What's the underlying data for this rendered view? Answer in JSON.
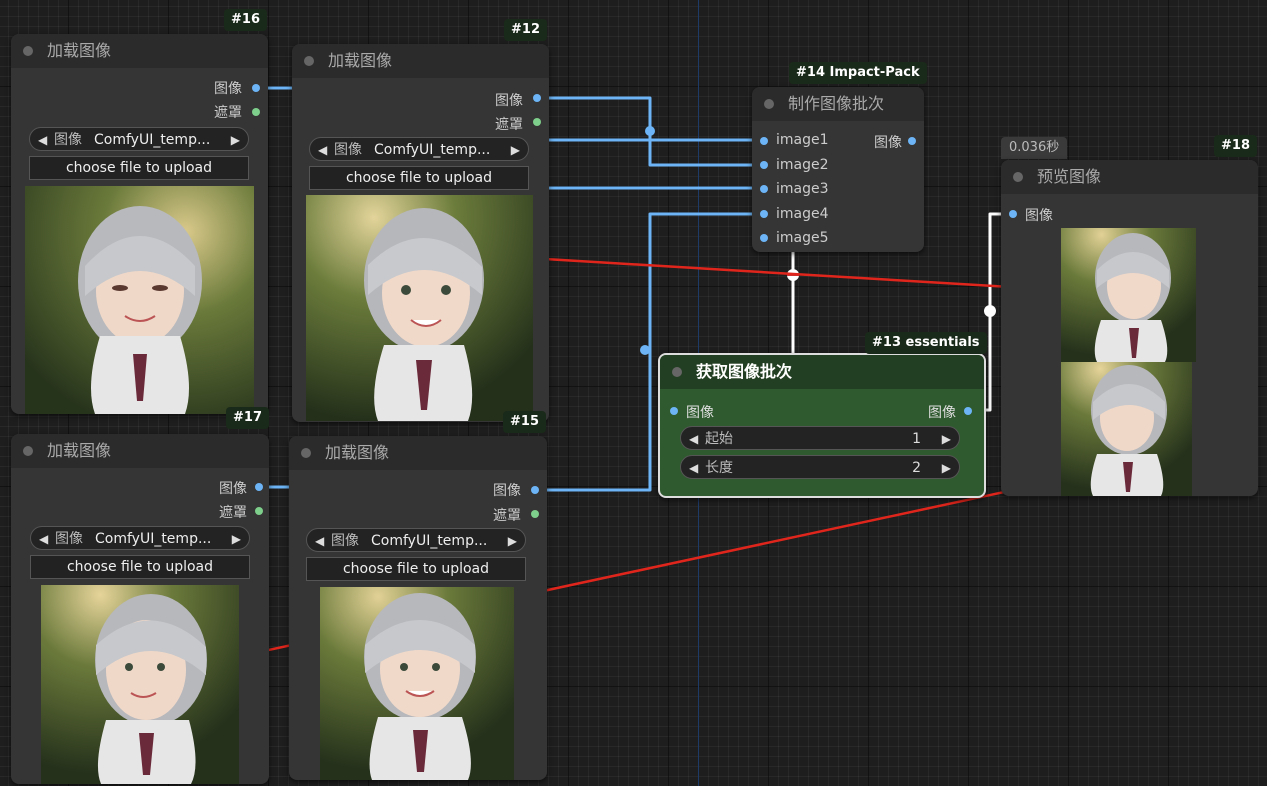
{
  "colors": {
    "link": "#6cb4f5",
    "link_white": "#ffffff",
    "arrow": "#e0261c",
    "essentials_body": "#2f5a2f",
    "essentials_title": "#233f23"
  },
  "nodes": {
    "n16": {
      "badge": "#16",
      "title": "加载图像",
      "out_image": "图像",
      "out_mask": "遮罩",
      "combo_label": "图像",
      "combo_value": "ComfyUI_temp...",
      "upload": "choose file to upload"
    },
    "n12": {
      "badge": "#12",
      "title": "加载图像",
      "out_image": "图像",
      "out_mask": "遮罩",
      "combo_label": "图像",
      "combo_value": "ComfyUI_temp...",
      "upload": "choose file to upload"
    },
    "n17": {
      "badge": "#17",
      "title": "加载图像",
      "out_image": "图像",
      "out_mask": "遮罩",
      "combo_label": "图像",
      "combo_value": "ComfyUI_temp...",
      "upload": "choose file to upload"
    },
    "n15": {
      "badge": "#15",
      "title": "加载图像",
      "out_image": "图像",
      "out_mask": "遮罩",
      "combo_label": "图像",
      "combo_value": "ComfyUI_temp...",
      "upload": "choose file to upload"
    },
    "n14": {
      "badge": "#14 Impact-Pack",
      "title": "制作图像批次",
      "inputs": [
        "image1",
        "image2",
        "image3",
        "image4",
        "image5"
      ],
      "output": "图像"
    },
    "n13": {
      "badge": "#13 essentials",
      "title": "获取图像批次",
      "input": "图像",
      "output": "图像",
      "w_start_label": "起始",
      "w_start_value": "1",
      "w_len_label": "长度",
      "w_len_value": "2"
    },
    "n18": {
      "badge": "#18",
      "title": "预览图像",
      "timing": "0.036秒",
      "input": "图像"
    }
  },
  "icons": {
    "left": "◀",
    "right": "▶"
  }
}
